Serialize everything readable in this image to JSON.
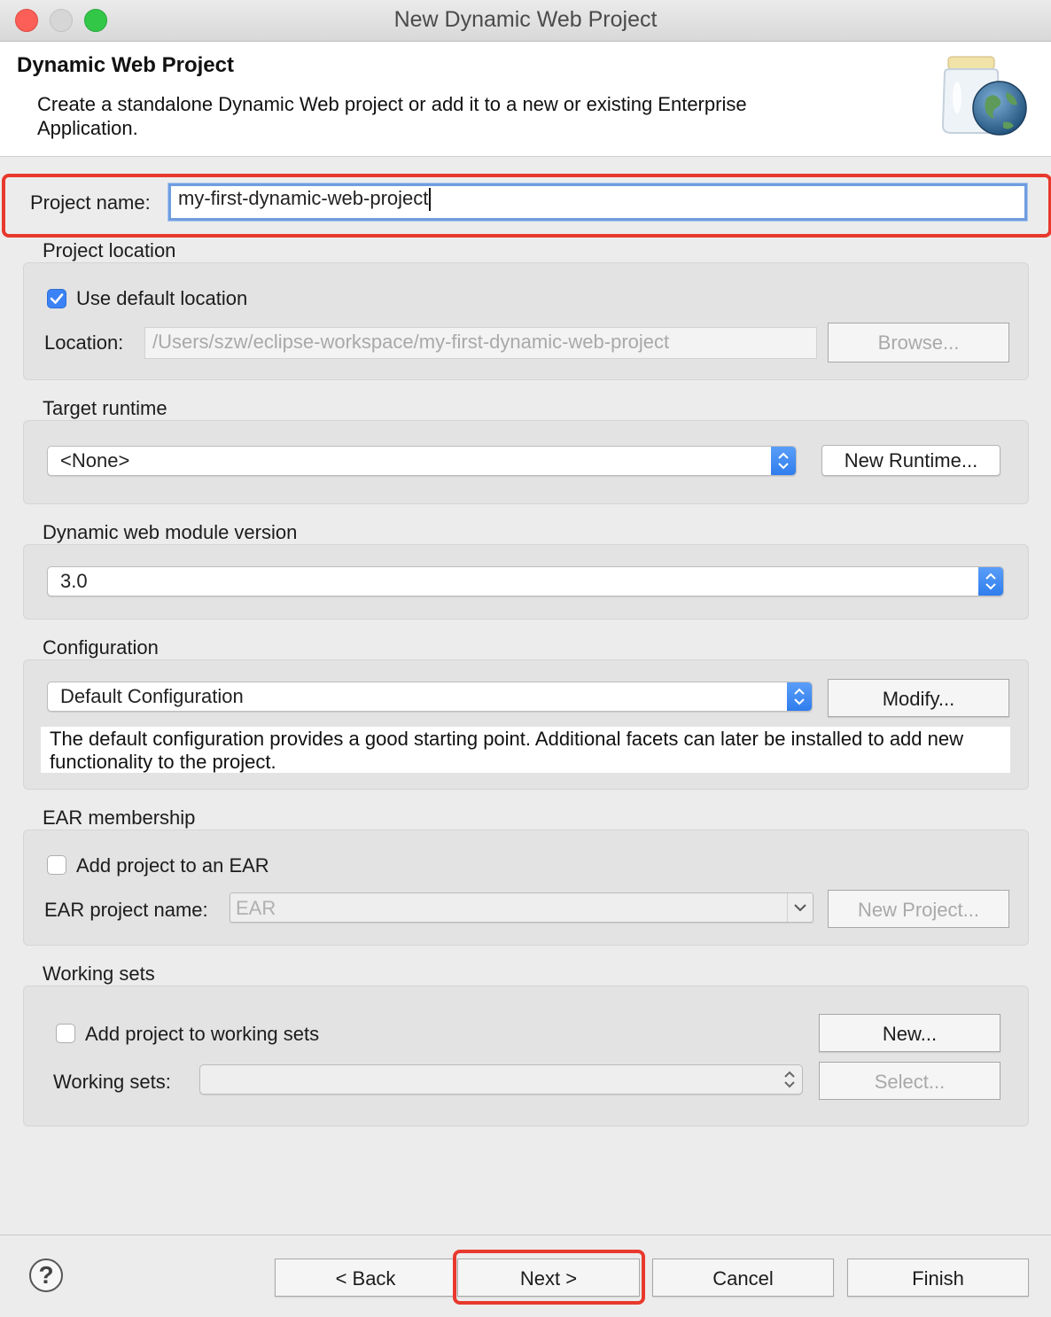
{
  "window": {
    "title": "New Dynamic Web Project"
  },
  "banner": {
    "title": "Dynamic Web Project",
    "description": "Create a standalone Dynamic Web project or add it to a new or existing Enterprise Application.",
    "icon": "web-project-jar-globe-icon"
  },
  "project_name": {
    "label": "Project name:",
    "value": "my-first-dynamic-web-project"
  },
  "project_location": {
    "title": "Project location",
    "use_default_label": "Use default location",
    "use_default_checked": true,
    "location_label": "Location:",
    "location_value": "/Users/szw/eclipse-workspace/my-first-dynamic-web-project",
    "browse_label": "Browse..."
  },
  "target_runtime": {
    "title": "Target runtime",
    "selected": "<None>",
    "new_runtime_label": "New Runtime..."
  },
  "module_version": {
    "title": "Dynamic web module version",
    "selected": "3.0"
  },
  "configuration": {
    "title": "Configuration",
    "selected": "Default Configuration",
    "modify_label": "Modify...",
    "description": "The default configuration provides a good starting point. Additional facets can later be installed to add new functionality to the project."
  },
  "ear": {
    "title": "EAR membership",
    "add_label": "Add project to an EAR",
    "add_checked": false,
    "name_label": "EAR project name:",
    "name_value": "EAR",
    "new_project_label": "New Project..."
  },
  "working_sets": {
    "title": "Working sets",
    "add_label": "Add project to working sets",
    "add_checked": false,
    "new_label": "New...",
    "sets_label": "Working sets:",
    "sets_value": "",
    "select_label": "Select..."
  },
  "footer": {
    "help": "?",
    "back_label": "< Back",
    "next_label": "Next >",
    "cancel_label": "Cancel",
    "finish_label": "Finish"
  },
  "colors": {
    "highlight": "#e8392d",
    "accent": "#3b82f6"
  }
}
